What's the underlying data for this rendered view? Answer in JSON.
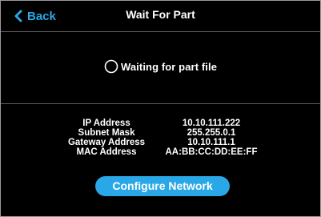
{
  "colors": {
    "accent": "#2aa7e6",
    "background": "#000000",
    "text": "#ffffff",
    "divider": "#5a5a5a"
  },
  "header": {
    "back_label": "Back",
    "back_icon": "chevron-left-icon",
    "title": "Wait For Part"
  },
  "status": {
    "icon": "spinner-icon",
    "text": "Waiting for part file"
  },
  "network": {
    "rows": [
      {
        "label": "IP Address",
        "value": "10.10.111.222"
      },
      {
        "label": "Subnet Mask",
        "value": "255.255.0.1"
      },
      {
        "label": "Gateway Address",
        "value": "10.10.111.1"
      },
      {
        "label": "MAC Address",
        "value": "AA:BB:CC:DD:EE:FF"
      }
    ],
    "configure_label": "Configure Network"
  }
}
